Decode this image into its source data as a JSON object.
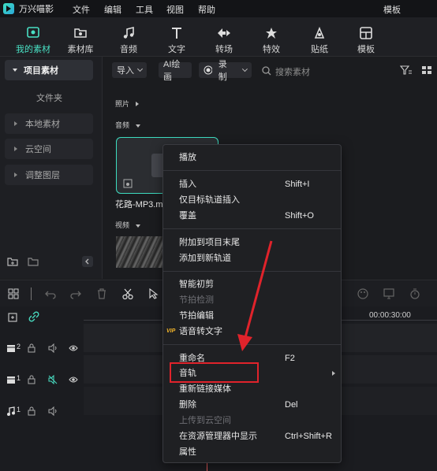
{
  "app": {
    "name": "万兴喵影"
  },
  "menubar": {
    "items": [
      "文件",
      "编辑",
      "工具",
      "视图",
      "帮助"
    ],
    "template": "模板"
  },
  "toolbar": {
    "tools": [
      {
        "label": "我的素材",
        "icon": "my-media-icon"
      },
      {
        "label": "素材库",
        "icon": "stock-library-icon"
      },
      {
        "label": "音频",
        "icon": "music-note-icon"
      },
      {
        "label": "文字",
        "icon": "text-icon"
      },
      {
        "label": "转场",
        "icon": "transition-icon"
      },
      {
        "label": "特效",
        "icon": "effects-icon"
      },
      {
        "label": "贴纸",
        "icon": "sticker-icon"
      },
      {
        "label": "模板",
        "icon": "template-icon"
      }
    ],
    "active": "我的素材"
  },
  "sidebar": {
    "project": "项目素材",
    "folder": "文件夹",
    "items": [
      "本地素材",
      "云空间",
      "调整图层"
    ]
  },
  "content": {
    "import": "导入",
    "ai_paint": "AI绘画",
    "record": "录制",
    "search_placeholder": "搜索素材",
    "sections": {
      "photo": "照片",
      "audio": "音频",
      "video": "视频"
    },
    "media_name": "花路-MP3.mp"
  },
  "timeline": {
    "time": "00:00:30:00",
    "tracks": [
      "2",
      "1",
      "1"
    ]
  },
  "context_menu": {
    "items": [
      {
        "label": "播放"
      },
      {
        "label": "插入",
        "shortcut": "Shift+I"
      },
      {
        "label": "仅目标轨道插入"
      },
      {
        "label": "覆盖",
        "shortcut": "Shift+O"
      },
      {
        "label": "附加到项目末尾"
      },
      {
        "label": "添加到新轨道"
      },
      {
        "label": "智能初剪"
      },
      {
        "label": "节拍检测",
        "disabled": true
      },
      {
        "label": "节拍编辑"
      },
      {
        "label": "语音转文字",
        "badge": "VIP"
      },
      {
        "label": "重命名",
        "shortcut": "F2"
      },
      {
        "label": "音轨",
        "submenu": true
      },
      {
        "label": "重新链接媒体"
      },
      {
        "label": "删除",
        "shortcut": "Del"
      },
      {
        "label": "上传到云空间",
        "disabled": true
      },
      {
        "label": "在资源管理器中显示",
        "shortcut": "Ctrl+Shift+R"
      },
      {
        "label": "属性"
      }
    ]
  },
  "colors": {
    "accent": "#49e0c4",
    "annotation": "#e0232b"
  }
}
